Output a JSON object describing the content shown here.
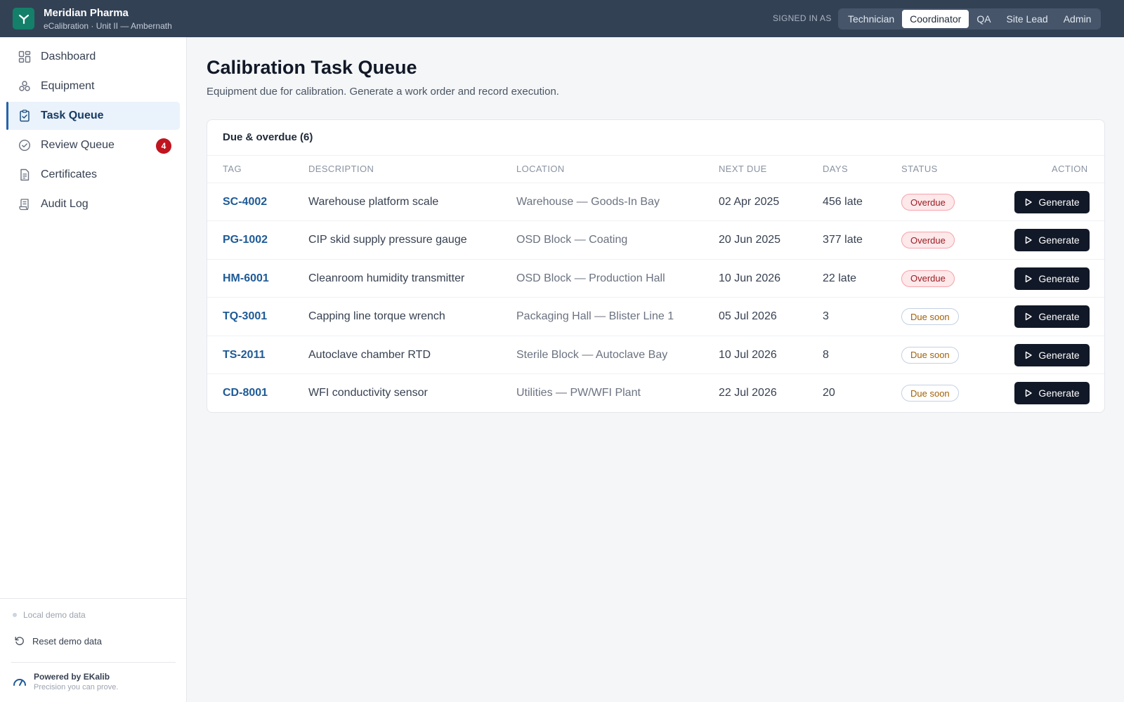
{
  "header": {
    "app_name": "Meridian Pharma",
    "app_sub": "eCalibration · Unit II — Ambernath",
    "signed_in_label": "SIGNED IN AS",
    "roles": [
      "Technician",
      "Coordinator",
      "QA",
      "Site Lead",
      "Admin"
    ],
    "active_role": "Coordinator"
  },
  "sidebar": {
    "items": [
      {
        "label": "Dashboard",
        "icon": "grid-icon"
      },
      {
        "label": "Equipment",
        "icon": "equipment-icon"
      },
      {
        "label": "Task Queue",
        "icon": "clipboard-check-icon",
        "active": true
      },
      {
        "label": "Review Queue",
        "icon": "check-circle-icon",
        "badge": "4"
      },
      {
        "label": "Certificates",
        "icon": "document-icon"
      },
      {
        "label": "Audit Log",
        "icon": "scroll-icon"
      }
    ],
    "footer": {
      "local_demo": "Local demo data",
      "reset_label": "Reset demo data",
      "powered_title": "Powered by EKalib",
      "powered_sub": "Precision you can prove."
    }
  },
  "main": {
    "title": "Calibration Task Queue",
    "subtitle": "Equipment due for calibration. Generate a work order and record execution.",
    "card_title": "Due & overdue (6)",
    "columns": [
      "TAG",
      "DESCRIPTION",
      "LOCATION",
      "NEXT DUE",
      "DAYS",
      "STATUS",
      "ACTION"
    ],
    "action_label": "Generate",
    "rows": [
      {
        "tag": "SC-4002",
        "description": "Warehouse platform scale",
        "location": "Warehouse — Goods-In Bay",
        "next_due": "02 Apr 2025",
        "days": "456 late",
        "status": "Overdue"
      },
      {
        "tag": "PG-1002",
        "description": "CIP skid supply pressure gauge",
        "location": "OSD Block — Coating",
        "next_due": "20 Jun 2025",
        "days": "377 late",
        "status": "Overdue"
      },
      {
        "tag": "HM-6001",
        "description": "Cleanroom humidity transmitter",
        "location": "OSD Block — Production Hall",
        "next_due": "10 Jun 2026",
        "days": "22 late",
        "status": "Overdue"
      },
      {
        "tag": "TQ-3001",
        "description": "Capping line torque wrench",
        "location": "Packaging Hall — Blister Line 1",
        "next_due": "05 Jul 2026",
        "days": "3",
        "status": "Due soon"
      },
      {
        "tag": "TS-2011",
        "description": "Autoclave chamber RTD",
        "location": "Sterile Block — Autoclave Bay",
        "next_due": "10 Jul 2026",
        "days": "8",
        "status": "Due soon"
      },
      {
        "tag": "CD-8001",
        "description": "WFI conductivity sensor",
        "location": "Utilities — PW/WFI Plant",
        "next_due": "22 Jul 2026",
        "days": "20",
        "status": "Due soon"
      }
    ]
  },
  "colors": {
    "topbar": "#334155",
    "brand_green": "#14806a",
    "accent_blue": "#2563a8",
    "overdue_red": "#9b1c22",
    "due_soon_amber": "#a16207",
    "button_dark": "#111827"
  }
}
